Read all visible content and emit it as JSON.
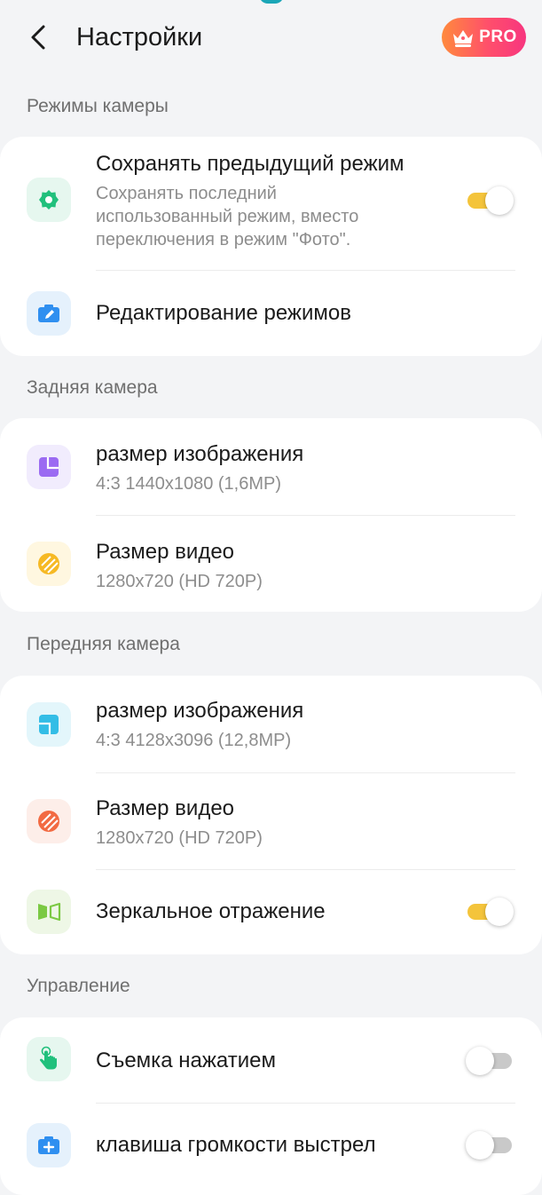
{
  "header": {
    "title": "Настройки",
    "pro_label": "PRO",
    "back_icon": "chevron-left-icon",
    "pro_icon": "crown-icon"
  },
  "colors": {
    "background": "#f3f4f6",
    "card": "#ffffff",
    "toggle_on": "#f4c43b",
    "toggle_off": "#c9c9c9",
    "pro_gradient": [
      "#ff8a3d",
      "#f7357f"
    ]
  },
  "sections": [
    {
      "label": "Режимы камеры",
      "items": [
        {
          "title": "Сохранять предыдущий режим",
          "description_lines": [
            "Сохранять последний",
            "использованный режим, вместо",
            "переключения в режим \"Фото\"."
          ],
          "icon": "mode-gear-icon",
          "toggle": true
        },
        {
          "title": "Редактирование режимов",
          "icon": "camera-edit-icon"
        }
      ]
    },
    {
      "label": "Задняя камера",
      "items": [
        {
          "title": "размер изображения",
          "value": "4:3 1440x1080 (1,6MP)",
          "icon": "image-size-icon"
        },
        {
          "title": "Размер видео",
          "value": "1280x720 (HD 720P)",
          "icon": "video-size-icon"
        }
      ]
    },
    {
      "label": "Передняя камера",
      "items": [
        {
          "title": "размер изображения",
          "value": "4:3 4128x3096 (12,8MP)",
          "icon": "image-size-icon"
        },
        {
          "title": "Размер видео",
          "value": "1280x720 (HD 720P)",
          "icon": "video-size-icon"
        },
        {
          "title": "Зеркальное отражение",
          "icon": "mirror-icon",
          "toggle": true
        }
      ]
    },
    {
      "label": "Управление",
      "items": [
        {
          "title": "Съемка нажатием",
          "icon": "tap-hand-icon",
          "toggle": false
        },
        {
          "title": "клавиша громкости выстрел",
          "icon": "volume-key-shot-icon",
          "toggle": false
        }
      ]
    }
  ]
}
